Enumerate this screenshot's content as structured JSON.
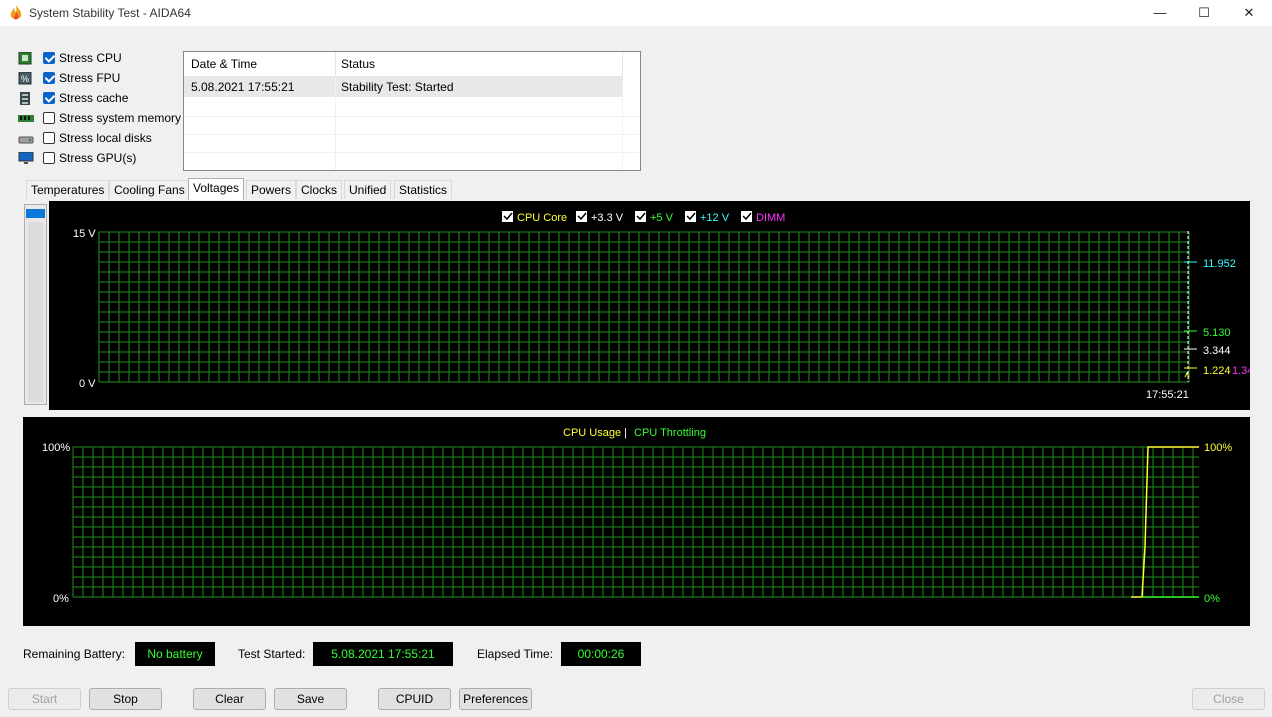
{
  "window": {
    "title": "System Stability Test - AIDA64",
    "minimize": "—",
    "maximize": "☐",
    "close": "✕"
  },
  "stress_options": [
    {
      "label": "Stress CPU",
      "checked": true,
      "icon": "cpu-icon"
    },
    {
      "label": "Stress FPU",
      "checked": true,
      "icon": "fpu-icon"
    },
    {
      "label": "Stress cache",
      "checked": true,
      "icon": "cache-icon"
    },
    {
      "label": "Stress system memory",
      "checked": false,
      "icon": "memory-icon"
    },
    {
      "label": "Stress local disks",
      "checked": false,
      "icon": "disk-icon"
    },
    {
      "label": "Stress GPU(s)",
      "checked": false,
      "icon": "monitor-icon"
    }
  ],
  "log": {
    "columns": [
      "Date & Time",
      "Status"
    ],
    "rows": [
      [
        "5.08.2021 17:55:21",
        "Stability Test: Started"
      ]
    ]
  },
  "tabs": [
    "Temperatures",
    "Cooling Fans",
    "Voltages",
    "Powers",
    "Clocks",
    "Unified",
    "Statistics"
  ],
  "active_tab": "Voltages",
  "voltage_graph": {
    "legend": [
      {
        "label": "CPU Core",
        "color": "#ffff33"
      },
      {
        "label": "+3.3 V",
        "color": "#ffffff"
      },
      {
        "label": "+5 V",
        "color": "#33ff33"
      },
      {
        "label": "+12 V",
        "color": "#33ffff"
      },
      {
        "label": "DIMM",
        "color": "#ff33ff"
      }
    ],
    "y_max_label": "15 V",
    "y_min_label": "0 V",
    "time_label": "17:55:21",
    "readouts": [
      {
        "value": "11.952",
        "color": "#33ffff"
      },
      {
        "value": "5.130",
        "color": "#33ff33"
      },
      {
        "value": "3.344",
        "color": "#ffffff"
      },
      {
        "value": "1.224",
        "color": "#ffff33"
      },
      {
        "value": "1.34",
        "color": "#ff33ff"
      }
    ]
  },
  "usage_graph": {
    "legend_usage": "CPU Usage",
    "separator": "|",
    "legend_throttling": "CPU Throttling",
    "usage_color": "#ffff33",
    "throttling_color": "#33ff33",
    "y_max_left": "100%",
    "y_min_left": "0%",
    "y_max_right": "100%",
    "y_min_right": "0%"
  },
  "status": {
    "battery_label": "Remaining Battery:",
    "battery_value": "No battery",
    "started_label": "Test Started:",
    "started_value": "5.08.2021 17:55:21",
    "elapsed_label": "Elapsed Time:",
    "elapsed_value": "00:00:26"
  },
  "buttons": {
    "start": "Start",
    "stop": "Stop",
    "clear": "Clear",
    "save": "Save",
    "cpuid": "CPUID",
    "preferences": "Preferences",
    "close": "Close"
  }
}
